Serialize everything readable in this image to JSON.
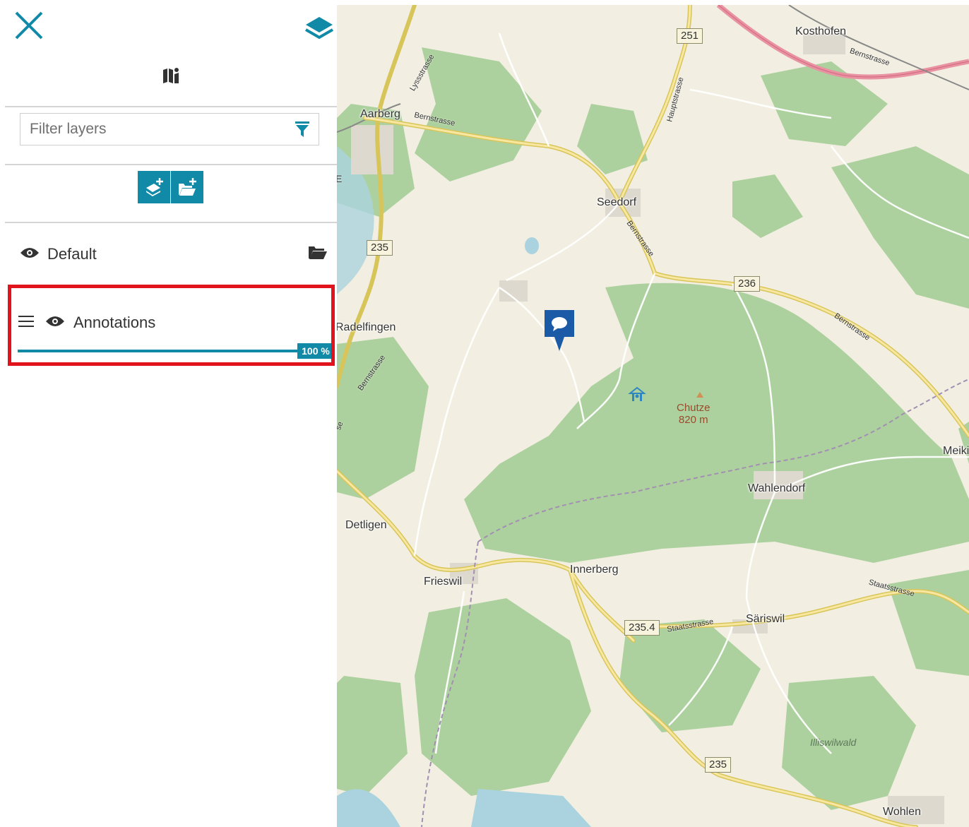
{
  "sidebar": {
    "filter": {
      "placeholder": "Filter layers",
      "value": ""
    },
    "layers": [
      {
        "name": "Default",
        "visible": true
      },
      {
        "name": "Annotations",
        "visible": true,
        "opacity_label": "100 %",
        "opacity": 1.0
      }
    ]
  },
  "map": {
    "places": {
      "kosthofen": "Kosthofen",
      "aarberg": "Aarberg",
      "seedorf": "Seedorf",
      "radelfingen": "Radelfingen",
      "detligen": "Detligen",
      "frieswil": "Frieswil",
      "innerberg": "Innerberg",
      "wahlendorf": "Wahlendorf",
      "sariswil": "Säriswil",
      "wohlen": "Wohlen",
      "meikirch": "Meikirc"
    },
    "peak": {
      "name": "Chutze",
      "elevation": "820 m"
    },
    "forest": "Illiswilwald",
    "road_refs": {
      "r251": "251",
      "r235a": "235",
      "r236": "236",
      "r2354": "235.4",
      "r235b": "235"
    },
    "streets": {
      "bern1": "Bernstrasse",
      "bern2": "Bernstrasse",
      "bern3": "Bernstrasse",
      "bern4": "Bernstrasse",
      "bern5": "Bernstrasse",
      "lyss": "Lyssstrasse",
      "haupt": "Hauptstrasse",
      "staats1": "Staatsstrasse",
      "staats2": "Staatsstrasse"
    },
    "edge_letters": {
      "e": "E",
      "se": "se"
    }
  },
  "colors": {
    "accent": "#118aa8",
    "highlight": "#e1141e",
    "forest": "#add19e",
    "motorway": "#e892a2"
  }
}
